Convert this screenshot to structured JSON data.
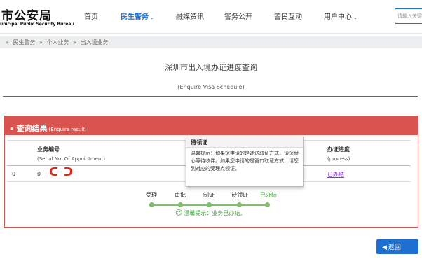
{
  "header": {
    "logo_main": "市公安局",
    "logo_sub": "unicipal Public Security Bureau",
    "nav": [
      "首页",
      "民生警务",
      "融媒资讯",
      "警务公开",
      "警民互动",
      "用户中心"
    ],
    "chevron": "⌄",
    "search_placeholder": "请输入关键词"
  },
  "breadcrumb": [
    "»",
    "民生警务",
    "»",
    "个人业务",
    "»",
    "出入境业务"
  ],
  "page": {
    "title": "深圳市出入境办证进度查询",
    "subtitle": "(Enquire Visa Schedule)"
  },
  "panel": {
    "icon": "share-alt-icon",
    "title": "查询结果",
    "title_en": "(Enquire result)",
    "columns": [
      {
        "cn": "业务编号",
        "en": "(Serial No. Of Appointment)"
      },
      {
        "cn": "办证进度",
        "en": "(process)"
      }
    ],
    "row": {
      "index": "0",
      "serial_prefix": "0",
      "serial_redacted": "ᑕᑐ",
      "progress_link": "已办结"
    }
  },
  "progress": {
    "steps": [
      "受理",
      "审批",
      "制证",
      "待领证",
      "已办结"
    ],
    "status_note": "温馨提示：业务已办结。"
  },
  "popover": {
    "title": "待领证",
    "body": "温馨提示：如果您申请的是递送取证方式，请您耐心等待收件。如果您申请的是窗口取证方式，请您到对应的受理点领证。"
  },
  "back_button": {
    "label": "返回",
    "icon": "left-arrow-icon"
  },
  "colors": {
    "primary": "#1e6fd0",
    "panel_red": "#d9534f",
    "success": "#3aa33a"
  }
}
